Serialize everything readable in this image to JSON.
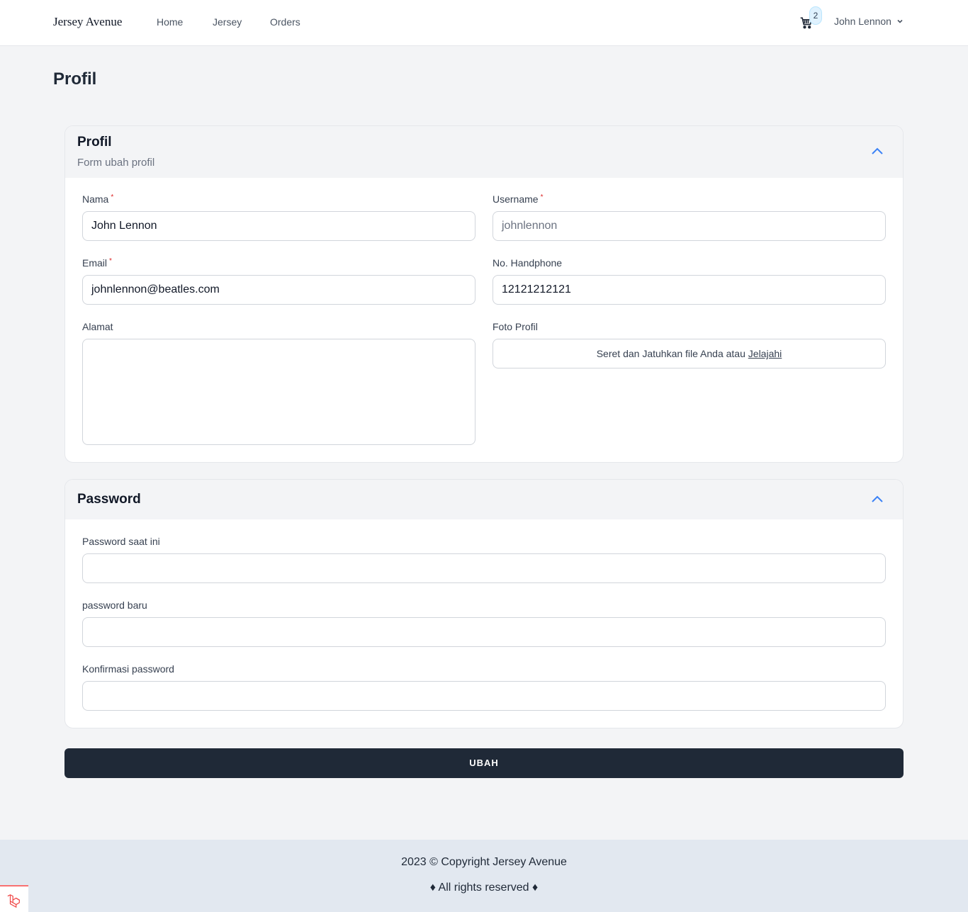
{
  "brand": "Jersey Avenue",
  "nav": {
    "items": [
      "Home",
      "Jersey",
      "Orders"
    ]
  },
  "cart": {
    "count": "2",
    "icon": "cart-icon"
  },
  "user": {
    "name": "John Lennon"
  },
  "page": {
    "title": "Profil"
  },
  "profile_card": {
    "title": "Profil",
    "subtitle": "Form ubah profil",
    "fields": {
      "nama": {
        "label": "Nama",
        "value": "John Lennon",
        "required": true
      },
      "username": {
        "label": "Username",
        "value": "johnlennon",
        "required": true
      },
      "email": {
        "label": "Email",
        "value": "johnlennon@beatles.com",
        "required": true
      },
      "phone": {
        "label": "No. Handphone",
        "value": "12121212121"
      },
      "alamat": {
        "label": "Alamat",
        "value": ""
      },
      "foto": {
        "label": "Foto Profil",
        "drop_text": "Seret dan Jatuhkan file Anda atau",
        "browse_text": "Jelajahi"
      }
    },
    "required_mark": "*"
  },
  "password_card": {
    "title": "Password",
    "fields": {
      "current": {
        "label": "Password saat ini"
      },
      "new": {
        "label": "password baru"
      },
      "confirm": {
        "label": "Konfirmasi password"
      }
    }
  },
  "submit_label": "UBAH",
  "footer": {
    "copyright": "2023 © Copyright Jersey Avenue",
    "rights": "♦ All rights reserved ♦"
  },
  "colors": {
    "accent": "#3b82f6",
    "primary_button": "#1f2937",
    "required": "#dc2626"
  }
}
